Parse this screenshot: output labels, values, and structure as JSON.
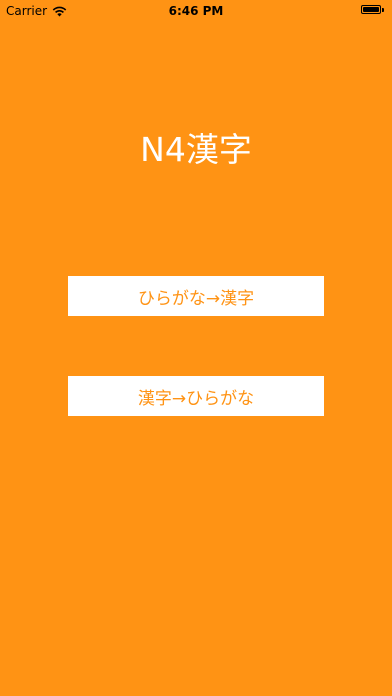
{
  "status_bar": {
    "carrier": "Carrier",
    "time": "6:46 PM",
    "wifi_icon": "wifi-icon",
    "battery_icon": "battery-icon"
  },
  "title": "N4漢字",
  "buttons": [
    {
      "label": "ひらがな→漢字"
    },
    {
      "label": "漢字→ひらがな"
    }
  ],
  "colors": {
    "background": "#FF9314",
    "title_text": "#FFFFFF",
    "button_background": "#FFFFFF",
    "button_text": "#FF9314"
  }
}
